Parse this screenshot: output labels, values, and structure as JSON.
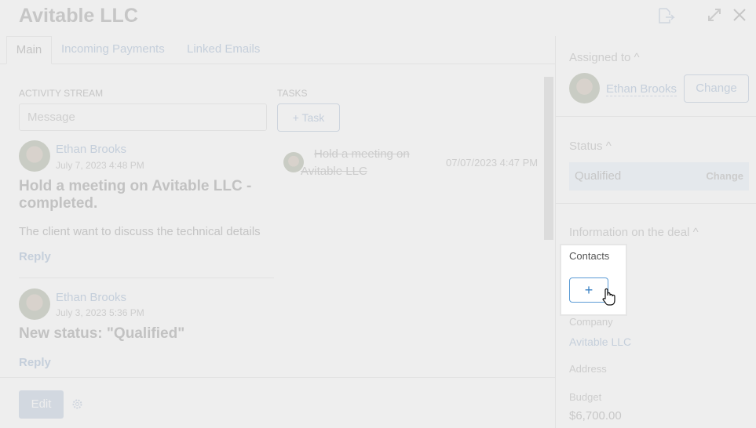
{
  "header": {
    "title": "Avitable LLC",
    "icons": [
      "export-icon",
      "expand-icon",
      "close-icon"
    ]
  },
  "tabs": [
    {
      "label": "Main"
    },
    {
      "label": "Incoming Payments"
    },
    {
      "label": "Linked Emails"
    }
  ],
  "activity": {
    "label": "ACTIVITY STREAM",
    "message_placeholder": "Message",
    "items": [
      {
        "author": "Ethan Brooks",
        "date": "July 7, 2023 4:48 PM",
        "title": "Hold a meeting on Avitable LLC - completed.",
        "body": "The client want  to discuss the technical details",
        "reply": "Reply"
      },
      {
        "author": "Ethan Brooks",
        "date": "July 3, 2023 5:36 PM",
        "title": "New status: \"Qualified\"",
        "reply": "Reply"
      }
    ]
  },
  "tasks": {
    "label": "TASKS",
    "add_label": "+ Task",
    "items": [
      {
        "title": "Hold a meeting on Avitable LLC",
        "date": "07/07/2023 4:47 PM"
      }
    ]
  },
  "footer": {
    "edit_label": "Edit"
  },
  "sidebar": {
    "assigned": {
      "title": "Assigned to ^",
      "name": "Ethan Brooks",
      "change": "Change"
    },
    "status": {
      "title": "Status ^",
      "value": "Qualified",
      "change": "Change"
    },
    "info": {
      "title": "Information on the deal ^",
      "contacts_label": "Contacts",
      "add_contact": "+",
      "company_label": "Company",
      "company_value": "Avitable LLC",
      "address_label": "Address",
      "budget_label": "Budget",
      "budget_value": "$6,700.00"
    }
  }
}
